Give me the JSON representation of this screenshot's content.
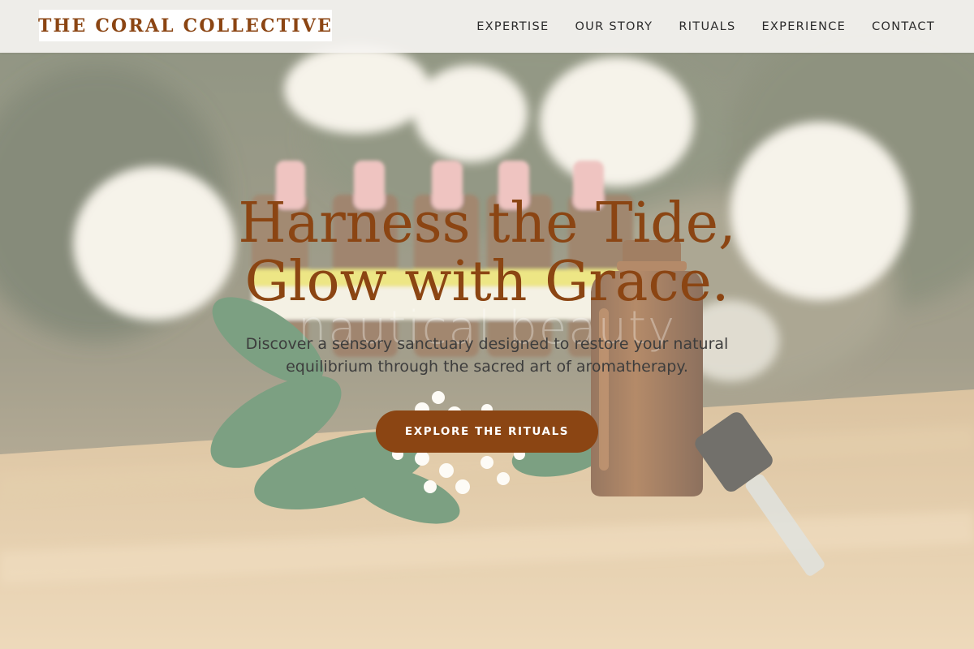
{
  "brand": {
    "logo_text": "THE CORAL COLLECTIVE",
    "accent_color": "#8b4513"
  },
  "nav": {
    "items": [
      {
        "label": "EXPERTISE"
      },
      {
        "label": "OUR STORY"
      },
      {
        "label": "RITUALS"
      },
      {
        "label": "EXPERIENCE"
      },
      {
        "label": "CONTACT"
      }
    ]
  },
  "hero": {
    "headline_line1": "Harness the Tide,",
    "headline_line2": "Glow with Grace.",
    "watermark": "nautical beauty",
    "subtext": "Discover a sensory sanctuary designed to restore your natural equilibrium through the sacred art of aromatherapy.",
    "cta_label": "EXPLORE THE RITUALS",
    "background_description_icon": "essential-oil-photo"
  }
}
